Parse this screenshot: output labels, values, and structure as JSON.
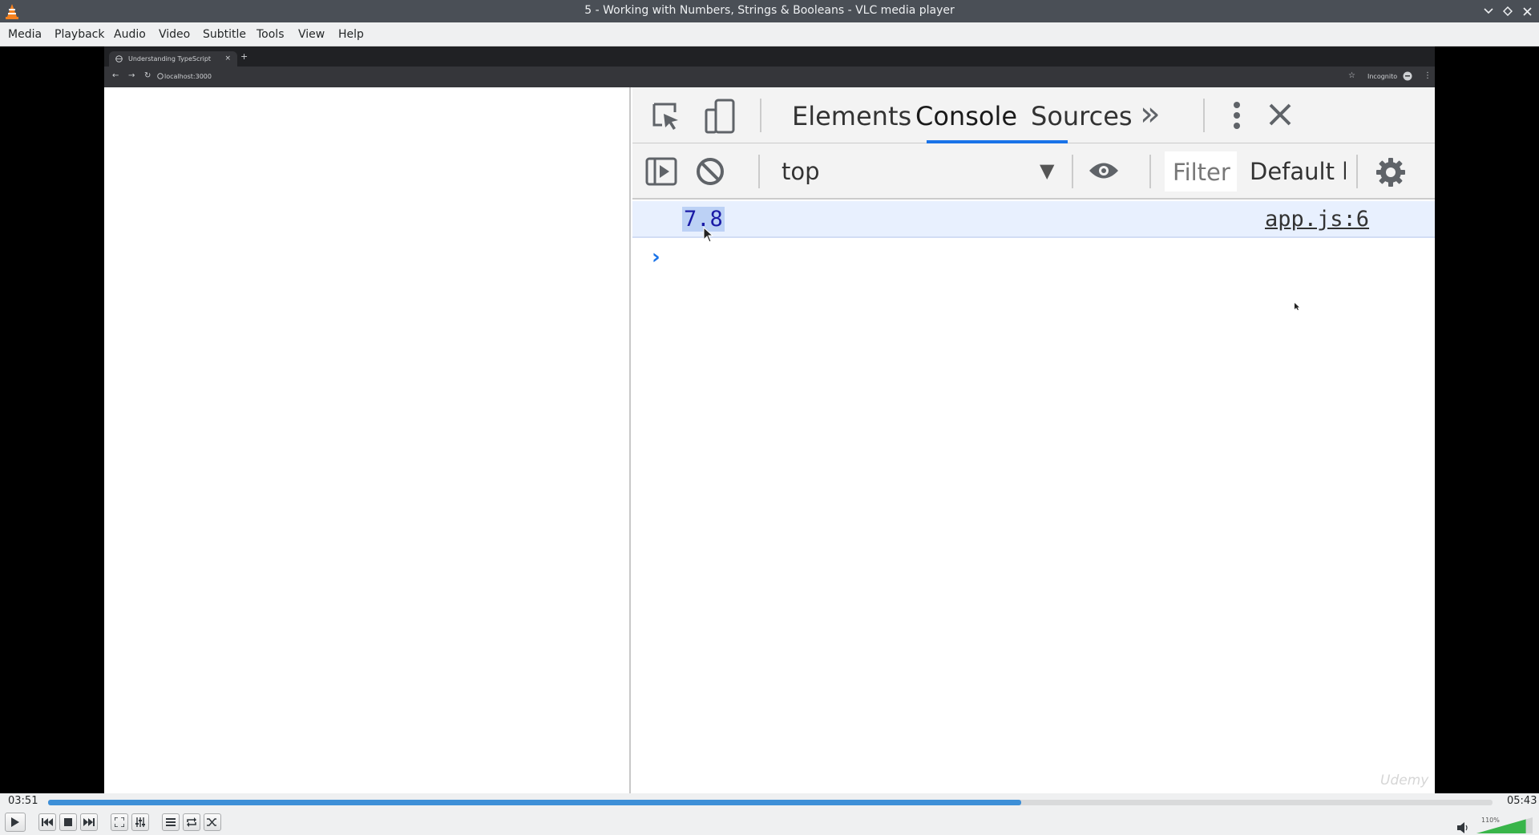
{
  "window": {
    "title": "5 - Working with Numbers, Strings & Booleans - VLC media player"
  },
  "menu": {
    "items": [
      "Media",
      "Playback",
      "Audio",
      "Video",
      "Subtitle",
      "Tools",
      "View",
      "Help"
    ]
  },
  "browser": {
    "tab_title": "Understanding TypeScript",
    "tab_close": "×",
    "new_tab": "+",
    "url": "localhost:3000",
    "incognito_label": "Incognito"
  },
  "devtools": {
    "tabs": [
      "Elements",
      "Console",
      "Sources"
    ],
    "active_tab": "Console",
    "more_tabs_label": "»",
    "context": "top",
    "filter_placeholder": "Filter",
    "levels_label": "Default levels",
    "console_output": [
      {
        "value": "7.8",
        "source": "app.js:6"
      }
    ],
    "prompt_symbol": "›"
  },
  "watermark": "Udemy",
  "player": {
    "elapsed": "03:51",
    "total": "05:43",
    "progress": 0.6735,
    "volume_label": "110%",
    "volume": 1.1,
    "accent_color": "#3d8fd7"
  }
}
